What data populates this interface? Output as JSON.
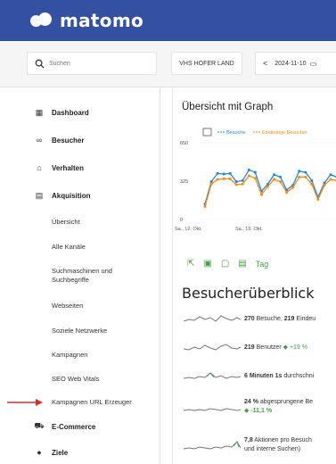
{
  "header": {
    "logo_text": "matomo",
    "brand_color": "#3450a3"
  },
  "search": {
    "placeholder": "Suchen"
  },
  "site_selector": {
    "label": "VHS HOFER LAND"
  },
  "date_selector": {
    "prev": "<",
    "date": "2024-11-10"
  },
  "sidebar": {
    "items": [
      {
        "icon": "dashboard-icon",
        "label": "Dashboard"
      },
      {
        "icon": "visitors-icon",
        "label": "Besucher"
      },
      {
        "icon": "behaviour-icon",
        "label": "Verhalten"
      },
      {
        "icon": "acquisition-icon",
        "label": "Akquisition"
      },
      {
        "icon": "ecommerce-icon",
        "label": "E-Commerce"
      },
      {
        "icon": "goals-icon",
        "label": "Ziele"
      }
    ],
    "subitems": [
      "Übersicht",
      "Alle Kanäle",
      "Suchmaschinen und Suchbegriffe",
      "Webseiten",
      "Soziele Netzwerke",
      "Kampagnen",
      "SEO Web Vitals",
      "Kampagnen URL Erzeuger"
    ]
  },
  "main": {
    "graph_title": "Übersicht mit Graph",
    "overview_title": "Besucherüberblick",
    "tag_label": "Tag"
  },
  "chart_data": {
    "type": "line",
    "x_ticks": [
      "Sa., 12. Okt.",
      "Sa., 19. Okt."
    ],
    "y_ticks": [
      "650",
      "325",
      "0"
    ],
    "ylim": [
      0,
      650
    ],
    "legend": [
      "Besuche",
      "Eindeutige Besucher"
    ],
    "series": [
      {
        "name": "Besuche",
        "color": "#1e88e5",
        "values": [
          130,
          320,
          390,
          385,
          390,
          320,
          330,
          420,
          400,
          240,
          300,
          380,
          360,
          250,
          290,
          410,
          400,
          330,
          190,
          310,
          380,
          360
        ]
      },
      {
        "name": "Eindeutige Besucher",
        "color": "#fb8c00",
        "values": [
          110,
          300,
          340,
          345,
          345,
          295,
          300,
          370,
          350,
          210,
          280,
          340,
          320,
          230,
          270,
          360,
          360,
          300,
          170,
          290,
          340,
          330
        ]
      }
    ]
  },
  "overview": {
    "rows": [
      {
        "value": "270",
        "text": " Besuche, ",
        "value2": "219",
        "text2": " Eindeu"
      },
      {
        "value": "219",
        "text": " Benutzer ",
        "change": "+19 %"
      },
      {
        "value": "6 Minuten 1s",
        "text": " durchschni"
      },
      {
        "value": "24 %",
        "text": " abgesprungene Be",
        "change": "-11,1 %"
      },
      {
        "value": "7,8",
        "text": " Aktionen pro Besuch",
        "line2": "und interne Suchen)"
      }
    ]
  }
}
